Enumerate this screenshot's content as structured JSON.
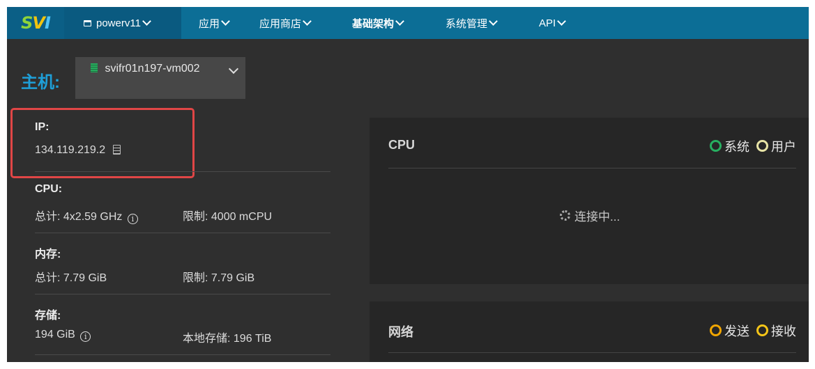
{
  "logo": {
    "s": "S",
    "v": "V",
    "i": "I"
  },
  "nav": {
    "project": "powerv11",
    "items": [
      "应用",
      "应用商店",
      "基础架构",
      "系统管理",
      "API"
    ]
  },
  "host": {
    "label": "主机:",
    "selected": "svifr01n197-vm002"
  },
  "info": {
    "ip": {
      "title": "IP:",
      "value": "134.119.219.2"
    },
    "cpu": {
      "title": "CPU:",
      "total": "总计: 4x2.59 GHz",
      "limit": "限制: 4000 mCPU"
    },
    "memory": {
      "title": "内存:",
      "total": "总计: 7.79 GiB",
      "limit": "限制: 7.79 GiB"
    },
    "storage": {
      "title": "存储:",
      "total": "194 GiB",
      "local": "本地存储: 196 TiB"
    }
  },
  "cpu_panel": {
    "title": "CPU",
    "legend": [
      "系统",
      "用户"
    ],
    "status": "连接中..."
  },
  "net_panel": {
    "title": "网络",
    "legend": [
      "发送",
      "接收"
    ]
  },
  "colors": {
    "nav_bg": "#0c6e96",
    "accent": "#1e9fd8",
    "legend_system": "#27ae60",
    "legend_user": "#e8e4a6",
    "legend_send": "#f0a500",
    "legend_receive": "#f5c518",
    "highlight": "#e04646"
  }
}
